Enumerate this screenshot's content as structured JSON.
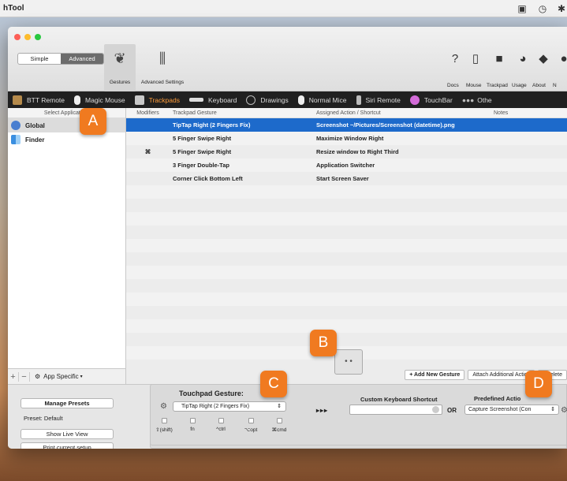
{
  "menubar": {
    "app_name": "hTool",
    "icons": [
      "window-icon",
      "clock-icon",
      "bluetooth-icon"
    ]
  },
  "toolbar": {
    "mode_simple": "Simple",
    "mode_advanced": "Advanced",
    "gestures_label": "Gestures",
    "advanced_settings_label": "Advanced Settings",
    "right_labels": [
      "Docs",
      "Mouse",
      "Trackpad",
      "Usage",
      "About",
      "N"
    ]
  },
  "devices": [
    {
      "label": "BTT Remote",
      "active": false
    },
    {
      "label": "Magic Mouse",
      "active": false
    },
    {
      "label": "Trackpads",
      "active": true
    },
    {
      "label": "Keyboard",
      "active": false
    },
    {
      "label": "Drawings",
      "active": false
    },
    {
      "label": "Normal Mice",
      "active": false
    },
    {
      "label": "Siri Remote",
      "active": false
    },
    {
      "label": "TouchBar",
      "active": false
    },
    {
      "label": "Othe",
      "active": false
    }
  ],
  "sidebar": {
    "header": "Select Application:",
    "items": [
      {
        "label": "Global",
        "selected": true
      },
      {
        "label": "Finder",
        "selected": false
      }
    ],
    "app_specific": "App Specific"
  },
  "table": {
    "headers": [
      "Modifiers",
      "Trackpad Gesture",
      "Assigned Action / Shortcut",
      "Notes"
    ],
    "rows": [
      {
        "modifier": "",
        "gesture": "TipTap Right (2 Fingers Fix)",
        "action": "Screenshot ~/Pictures/Screenshot (datetime).png",
        "notes": "",
        "selected": true
      },
      {
        "modifier": "",
        "gesture": "5 Finger Swipe Right",
        "action": "Maximize Window Right",
        "notes": "",
        "selected": false
      },
      {
        "modifier": "⌘",
        "gesture": "5 Finger Swipe Right",
        "action": "Resize window to Right Third",
        "notes": "",
        "selected": false
      },
      {
        "modifier": "",
        "gesture": "3 Finger Double-Tap",
        "action": "Application Switcher",
        "notes": "",
        "selected": false
      },
      {
        "modifier": "",
        "gesture": "Corner Click Bottom Left",
        "action": "Start Screen Saver",
        "notes": "",
        "selected": false
      }
    ]
  },
  "actions": {
    "add": "+ Add New Gesture",
    "attach": "Attach Additional Action",
    "delete": "- Delete"
  },
  "left_panel": {
    "manage_presets": "Manage Presets",
    "preset": "Preset: Default",
    "show_live_view": "Show Live View",
    "print_setup": "Print current setup",
    "help": "?"
  },
  "gesture_panel": {
    "title": "Touchpad Gesture:",
    "selected_gesture": "TipTap Right (2 Fingers Fix)",
    "modifiers": [
      "⇧(shift)",
      "fn",
      "^ctrl",
      "⌥opt",
      "⌘cmd"
    ],
    "arrows": "▸▸▸",
    "custom_shortcut_label": "Custom Keyboard Shortcut",
    "or": "OR",
    "predefined_label": "Predefined Actio",
    "predefined_value": "Capture Screenshot (Con"
  },
  "badges": [
    "A",
    "B",
    "C",
    "D"
  ]
}
